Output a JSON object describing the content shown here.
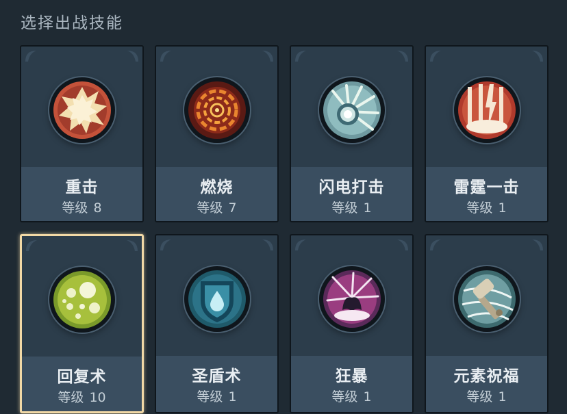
{
  "header": {
    "title": "选择出战技能"
  },
  "skills": [
    {
      "name": "重击",
      "level_label": "等级",
      "level": "8",
      "icon": "heavy-strike-icon",
      "selected": false
    },
    {
      "name": "燃烧",
      "level_label": "等级",
      "level": "7",
      "icon": "burn-icon",
      "selected": false
    },
    {
      "name": "闪电打击",
      "level_label": "等级",
      "level": "1",
      "icon": "lightning-strike-icon",
      "selected": false
    },
    {
      "name": "雷霆一击",
      "level_label": "等级",
      "level": "1",
      "icon": "thunder-strike-icon",
      "selected": false
    },
    {
      "name": "回复术",
      "level_label": "等级",
      "level": "10",
      "icon": "heal-icon",
      "selected": true
    },
    {
      "name": "圣盾术",
      "level_label": "等级",
      "level": "1",
      "icon": "holy-shield-icon",
      "selected": false
    },
    {
      "name": "狂暴",
      "level_label": "等级",
      "level": "1",
      "icon": "berserk-icon",
      "selected": false
    },
    {
      "name": "元素祝福",
      "level_label": "等级",
      "level": "1",
      "icon": "elemental-blessing-icon",
      "selected": false
    }
  ],
  "colors": {
    "background": "#1f2a33",
    "card": "#2c3d4b",
    "card_footer": "#3a4e60",
    "selected_border": "#f2d9a6"
  }
}
